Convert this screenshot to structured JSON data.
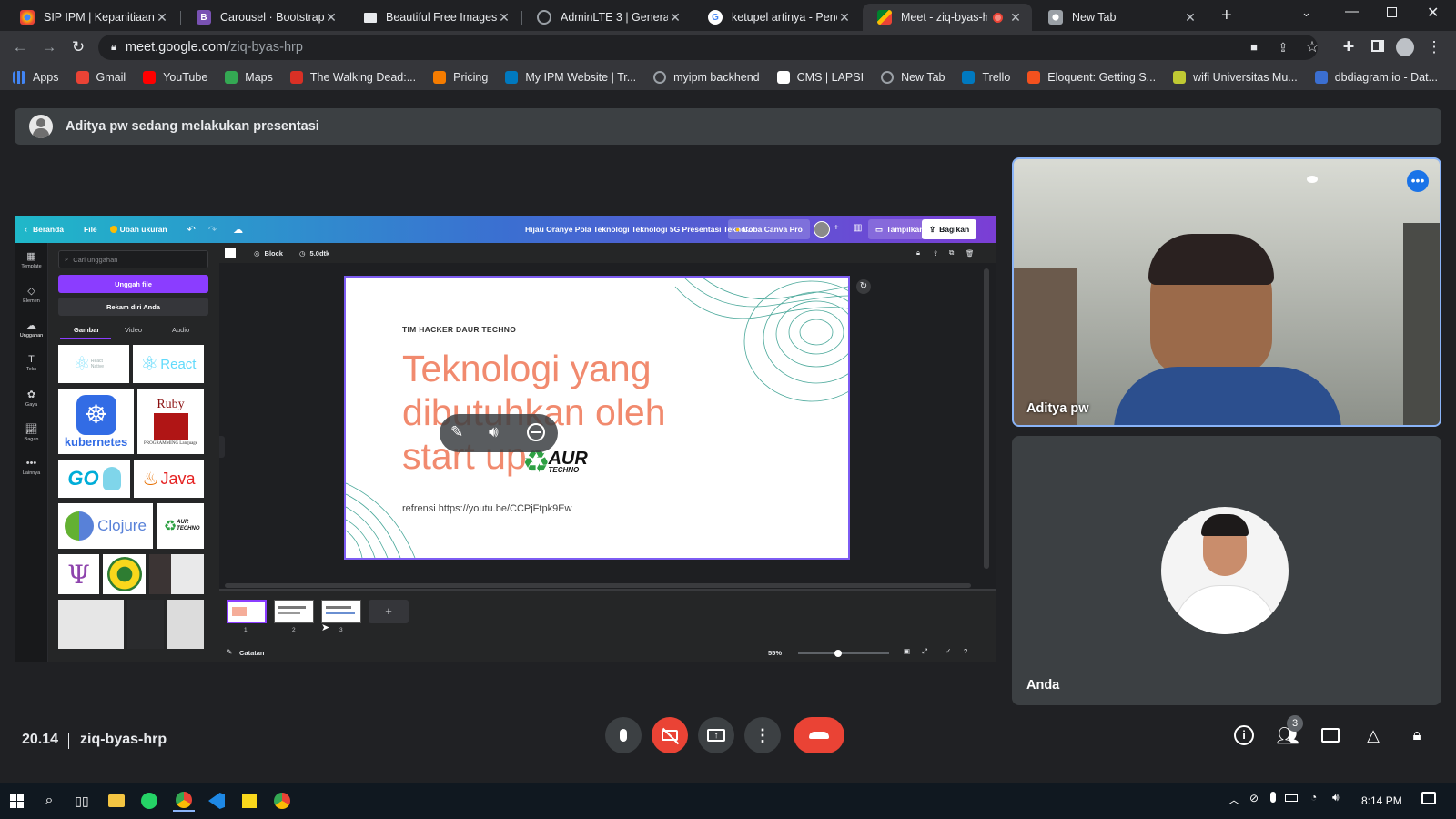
{
  "browser": {
    "tabs": [
      {
        "title": "SIP IPM | Kepanitiaan",
        "active": false
      },
      {
        "title": "Carousel · Bootstrap v5",
        "active": false
      },
      {
        "title": "Beautiful Free Images &",
        "active": false
      },
      {
        "title": "AdminLTE 3 | General Fo",
        "active": false
      },
      {
        "title": "ketupel artinya - Penelu",
        "active": false
      },
      {
        "title": "Meet - ziq-byas-hrp",
        "active": true
      },
      {
        "title": "New Tab",
        "active": false
      }
    ],
    "new_tab_label": "+",
    "address": {
      "host": "meet.google.com",
      "path": "/ziq-byas-hrp"
    },
    "bookmarks": [
      {
        "label": "Apps",
        "icon": "apps-grid-icon",
        "color": "#4285f4"
      },
      {
        "label": "Gmail",
        "icon": "gmail-icon",
        "color": "#ea4335"
      },
      {
        "label": "YouTube",
        "icon": "youtube-icon",
        "color": "#ff0000"
      },
      {
        "label": "Maps",
        "icon": "maps-icon",
        "color": "#34a853"
      },
      {
        "label": "The Walking Dead:...",
        "icon": "walking-dead-icon",
        "color": "#d93025"
      },
      {
        "label": "Pricing",
        "icon": "pricing-icon",
        "color": "#f57c00"
      },
      {
        "label": "My IPM Website | Tr...",
        "icon": "trello-icon",
        "color": "#0079bf"
      },
      {
        "label": "myipm backhend",
        "icon": "globe-icon",
        "color": "#9aa0a6"
      },
      {
        "label": "CMS | LAPSI",
        "icon": "page-icon",
        "color": "#ffffff"
      },
      {
        "label": "New Tab",
        "icon": "globe-icon",
        "color": "#9aa0a6"
      },
      {
        "label": "Trello",
        "icon": "trello-icon",
        "color": "#0079bf"
      },
      {
        "label": "Eloquent: Getting S...",
        "icon": "laravel-icon",
        "color": "#f4511e"
      },
      {
        "label": "wifi Universitas Mu...",
        "icon": "university-icon",
        "color": "#c0ca33"
      },
      {
        "label": "dbdiagram.io - Dat...",
        "icon": "dbdiagram-icon",
        "color": "#3b6fd1"
      }
    ]
  },
  "meet": {
    "banner": "Aditya pw sedang melakukan presentasi",
    "presenter_name": "Aditya pw",
    "self_name": "Anda",
    "clock": "20.14",
    "meeting_code": "ziq-byas-hrp",
    "participants_count": "3",
    "colors": {
      "end_call": "#ea4335",
      "camera_off": "#ea4335",
      "accent": "#8ab4f8"
    }
  },
  "canva": {
    "top_bar": {
      "home": "Beranda",
      "file": "File",
      "resize": "Ubah ukuran",
      "doc_title": "Hijau Oranye Pola Teknologi Teknologi 5G Presentasi Teknol...",
      "try_pro": "Coba Canva Pro",
      "present": "Tampilkan",
      "share": "Bagikan"
    },
    "sidebar": [
      {
        "label": "Template",
        "icon": "template-icon"
      },
      {
        "label": "Elemen",
        "icon": "elements-icon"
      },
      {
        "label": "Unggahan",
        "icon": "upload-cloud-icon"
      },
      {
        "label": "Teks",
        "icon": "text-icon"
      },
      {
        "label": "Gaya",
        "icon": "style-icon"
      },
      {
        "label": "Bagan",
        "icon": "chart-icon"
      },
      {
        "label": "Lainnya",
        "icon": "more-icon"
      }
    ],
    "panel": {
      "search_placeholder": "Cari unggahan",
      "upload_button": "Unggah file",
      "record_button": "Rekam diri Anda",
      "subtabs": [
        "Gambar",
        "Video",
        "Audio"
      ],
      "thumbs": [
        "React Native",
        "React",
        "kubernetes",
        "Ruby",
        "PROGRAMMING Language",
        "GO",
        "Java",
        "Clojure",
        "AUR TECHNO"
      ]
    },
    "context_bar": {
      "block": "Block",
      "duration": "5.0dtk"
    },
    "slide": {
      "subtitle": "TIM HACKER DAUR TECHNO",
      "title_lines": [
        "Teknologi yang",
        "dibutuhkan oleh",
        "start up"
      ],
      "logo_text": "AUR",
      "logo_sub": "TECHNO",
      "reference": "refrensi https://youtu.be/CCPjFtpk9Ew"
    },
    "pages": [
      "1",
      "2",
      "3"
    ],
    "add_page": "+",
    "notes_label": "Catatan",
    "zoom": "55%",
    "zoom_fraction": 0.44
  },
  "taskbar": {
    "time": "8:14 PM"
  }
}
